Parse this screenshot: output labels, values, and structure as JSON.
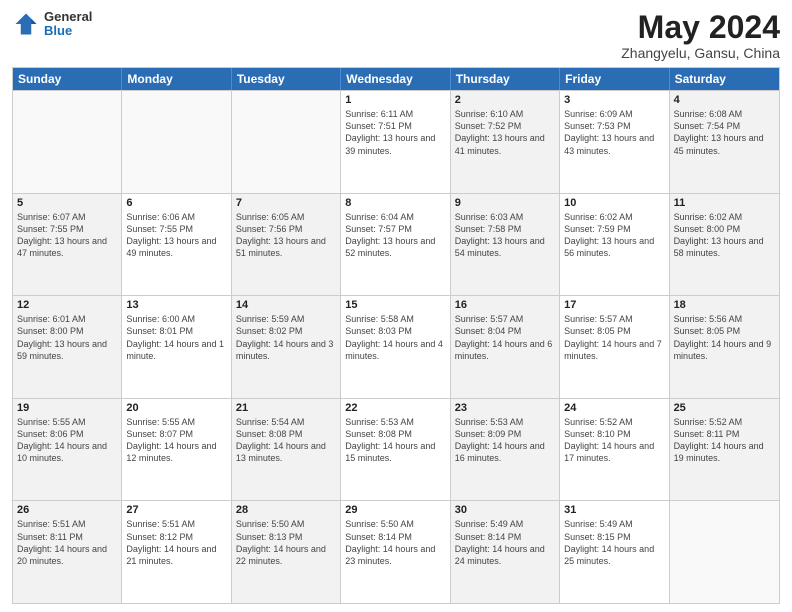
{
  "header": {
    "logo_general": "General",
    "logo_blue": "Blue",
    "title": "May 2024",
    "subtitle": "Zhangyelu, Gansu, China"
  },
  "weekdays": [
    "Sunday",
    "Monday",
    "Tuesday",
    "Wednesday",
    "Thursday",
    "Friday",
    "Saturday"
  ],
  "weeks": [
    [
      {
        "day": "",
        "info": ""
      },
      {
        "day": "",
        "info": ""
      },
      {
        "day": "",
        "info": ""
      },
      {
        "day": "1",
        "info": "Sunrise: 6:11 AM\nSunset: 7:51 PM\nDaylight: 13 hours and 39 minutes."
      },
      {
        "day": "2",
        "info": "Sunrise: 6:10 AM\nSunset: 7:52 PM\nDaylight: 13 hours and 41 minutes."
      },
      {
        "day": "3",
        "info": "Sunrise: 6:09 AM\nSunset: 7:53 PM\nDaylight: 13 hours and 43 minutes."
      },
      {
        "day": "4",
        "info": "Sunrise: 6:08 AM\nSunset: 7:54 PM\nDaylight: 13 hours and 45 minutes."
      }
    ],
    [
      {
        "day": "5",
        "info": "Sunrise: 6:07 AM\nSunset: 7:55 PM\nDaylight: 13 hours and 47 minutes."
      },
      {
        "day": "6",
        "info": "Sunrise: 6:06 AM\nSunset: 7:55 PM\nDaylight: 13 hours and 49 minutes."
      },
      {
        "day": "7",
        "info": "Sunrise: 6:05 AM\nSunset: 7:56 PM\nDaylight: 13 hours and 51 minutes."
      },
      {
        "day": "8",
        "info": "Sunrise: 6:04 AM\nSunset: 7:57 PM\nDaylight: 13 hours and 52 minutes."
      },
      {
        "day": "9",
        "info": "Sunrise: 6:03 AM\nSunset: 7:58 PM\nDaylight: 13 hours and 54 minutes."
      },
      {
        "day": "10",
        "info": "Sunrise: 6:02 AM\nSunset: 7:59 PM\nDaylight: 13 hours and 56 minutes."
      },
      {
        "day": "11",
        "info": "Sunrise: 6:02 AM\nSunset: 8:00 PM\nDaylight: 13 hours and 58 minutes."
      }
    ],
    [
      {
        "day": "12",
        "info": "Sunrise: 6:01 AM\nSunset: 8:00 PM\nDaylight: 13 hours and 59 minutes."
      },
      {
        "day": "13",
        "info": "Sunrise: 6:00 AM\nSunset: 8:01 PM\nDaylight: 14 hours and 1 minute."
      },
      {
        "day": "14",
        "info": "Sunrise: 5:59 AM\nSunset: 8:02 PM\nDaylight: 14 hours and 3 minutes."
      },
      {
        "day": "15",
        "info": "Sunrise: 5:58 AM\nSunset: 8:03 PM\nDaylight: 14 hours and 4 minutes."
      },
      {
        "day": "16",
        "info": "Sunrise: 5:57 AM\nSunset: 8:04 PM\nDaylight: 14 hours and 6 minutes."
      },
      {
        "day": "17",
        "info": "Sunrise: 5:57 AM\nSunset: 8:05 PM\nDaylight: 14 hours and 7 minutes."
      },
      {
        "day": "18",
        "info": "Sunrise: 5:56 AM\nSunset: 8:05 PM\nDaylight: 14 hours and 9 minutes."
      }
    ],
    [
      {
        "day": "19",
        "info": "Sunrise: 5:55 AM\nSunset: 8:06 PM\nDaylight: 14 hours and 10 minutes."
      },
      {
        "day": "20",
        "info": "Sunrise: 5:55 AM\nSunset: 8:07 PM\nDaylight: 14 hours and 12 minutes."
      },
      {
        "day": "21",
        "info": "Sunrise: 5:54 AM\nSunset: 8:08 PM\nDaylight: 14 hours and 13 minutes."
      },
      {
        "day": "22",
        "info": "Sunrise: 5:53 AM\nSunset: 8:08 PM\nDaylight: 14 hours and 15 minutes."
      },
      {
        "day": "23",
        "info": "Sunrise: 5:53 AM\nSunset: 8:09 PM\nDaylight: 14 hours and 16 minutes."
      },
      {
        "day": "24",
        "info": "Sunrise: 5:52 AM\nSunset: 8:10 PM\nDaylight: 14 hours and 17 minutes."
      },
      {
        "day": "25",
        "info": "Sunrise: 5:52 AM\nSunset: 8:11 PM\nDaylight: 14 hours and 19 minutes."
      }
    ],
    [
      {
        "day": "26",
        "info": "Sunrise: 5:51 AM\nSunset: 8:11 PM\nDaylight: 14 hours and 20 minutes."
      },
      {
        "day": "27",
        "info": "Sunrise: 5:51 AM\nSunset: 8:12 PM\nDaylight: 14 hours and 21 minutes."
      },
      {
        "day": "28",
        "info": "Sunrise: 5:50 AM\nSunset: 8:13 PM\nDaylight: 14 hours and 22 minutes."
      },
      {
        "day": "29",
        "info": "Sunrise: 5:50 AM\nSunset: 8:14 PM\nDaylight: 14 hours and 23 minutes."
      },
      {
        "day": "30",
        "info": "Sunrise: 5:49 AM\nSunset: 8:14 PM\nDaylight: 14 hours and 24 minutes."
      },
      {
        "day": "31",
        "info": "Sunrise: 5:49 AM\nSunset: 8:15 PM\nDaylight: 14 hours and 25 minutes."
      },
      {
        "day": "",
        "info": ""
      }
    ]
  ]
}
